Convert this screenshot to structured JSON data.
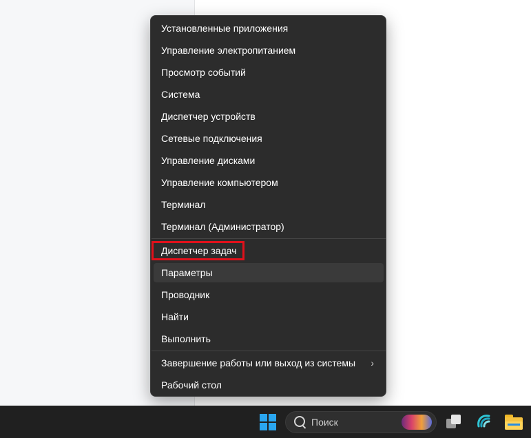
{
  "context_menu": {
    "items": [
      {
        "label": "Установленные приложения"
      },
      {
        "label": "Управление электропитанием"
      },
      {
        "label": "Просмотр событий"
      },
      {
        "label": "Система"
      },
      {
        "label": "Диспетчер устройств"
      },
      {
        "label": "Сетевые подключения"
      },
      {
        "label": "Управление дисками"
      },
      {
        "label": "Управление компьютером"
      },
      {
        "label": "Терминал"
      },
      {
        "label": "Терминал (Администратор)"
      },
      {
        "label": "Диспетчер задач",
        "highlighted": true
      },
      {
        "label": "Параметры",
        "hovered": true
      },
      {
        "label": "Проводник"
      },
      {
        "label": "Найти"
      },
      {
        "label": "Выполнить"
      },
      {
        "label": "Завершение работы или выход из системы",
        "has_submenu": true
      },
      {
        "label": "Рабочий стол"
      }
    ],
    "chevron_glyph": "›"
  },
  "taskbar": {
    "search": {
      "label": "Поиск",
      "icon": "search-icon"
    },
    "start_icon": "windows-logo-icon",
    "apps": [
      "task-view-icon",
      "copilot-icon",
      "file-explorer-icon"
    ]
  },
  "colors": {
    "menu_bg": "#2c2c2c",
    "highlight_border": "#e0111b",
    "taskbar_bg": "#202020",
    "start_blue": "#2aa6f0"
  }
}
